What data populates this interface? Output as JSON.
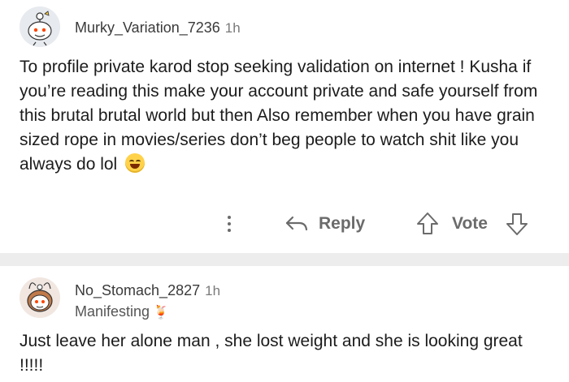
{
  "comments": [
    {
      "author": "Murky_Variation_7236",
      "time": "1h",
      "body": "To profile private karod stop seeking validation on internet ! Kusha if you’re reading this make your account private and safe yourself from this brutal brutal world but then Also remember when you have grain sized rope in movies/series don’t beg people to watch shit like you always do lol",
      "emoji": "grinning-sweat-emoji",
      "actions": {
        "more": "more-options-icon",
        "reply_label": "Reply",
        "vote_label": "Vote"
      }
    },
    {
      "author": "No_Stomach_2827",
      "time": "1h",
      "flair": "Manifesting",
      "flair_emoji": "🍹",
      "body": "Just leave her alone man , she lost weight and she is looking great !!!!!"
    }
  ],
  "colors": {
    "text": "#1c1c1c",
    "meta": "#7a7a7a",
    "divider": "#ededed",
    "icon": "#6b6b6b"
  }
}
